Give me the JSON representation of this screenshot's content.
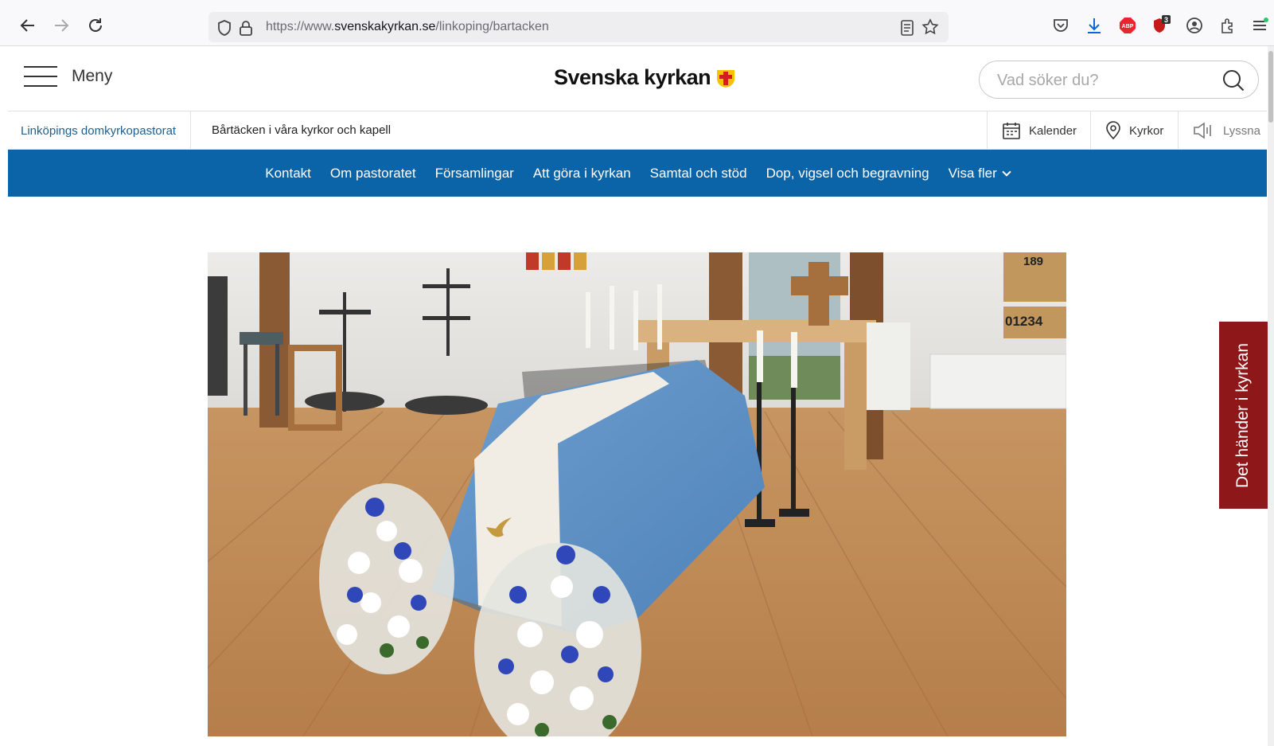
{
  "browser": {
    "url_prefix": "https://www.",
    "url_domain": "svenskakyrkan.se",
    "url_path": "/linkoping/bartacken",
    "badge_count": "3",
    "abp_label": "ABP"
  },
  "header": {
    "menu_label": "Meny",
    "logo_text": "Svenska kyrkan",
    "search_placeholder": "Vad söker du?"
  },
  "subheader": {
    "pastorat": "Linköpings domkyrkopastorat",
    "page_title": "Bårtäcken i våra kyrkor och kapell",
    "calendar": "Kalender",
    "churches": "Kyrkor",
    "listen": "Lyssna"
  },
  "nav": {
    "items": [
      "Kontakt",
      "Om pastoratet",
      "Församlingar",
      "Att göra i kyrkan",
      "Samtal och stöd",
      "Dop, vigsel och begravning"
    ],
    "more": "Visa fler"
  },
  "hero": {
    "number_top": "189",
    "number_board": "01234"
  },
  "side_tab": {
    "label": "Det händer i kyrkan"
  },
  "colors": {
    "nav_blue": "#0b63a8",
    "side_tab_red": "#8e1719",
    "link_blue": "#1f5f8f"
  }
}
